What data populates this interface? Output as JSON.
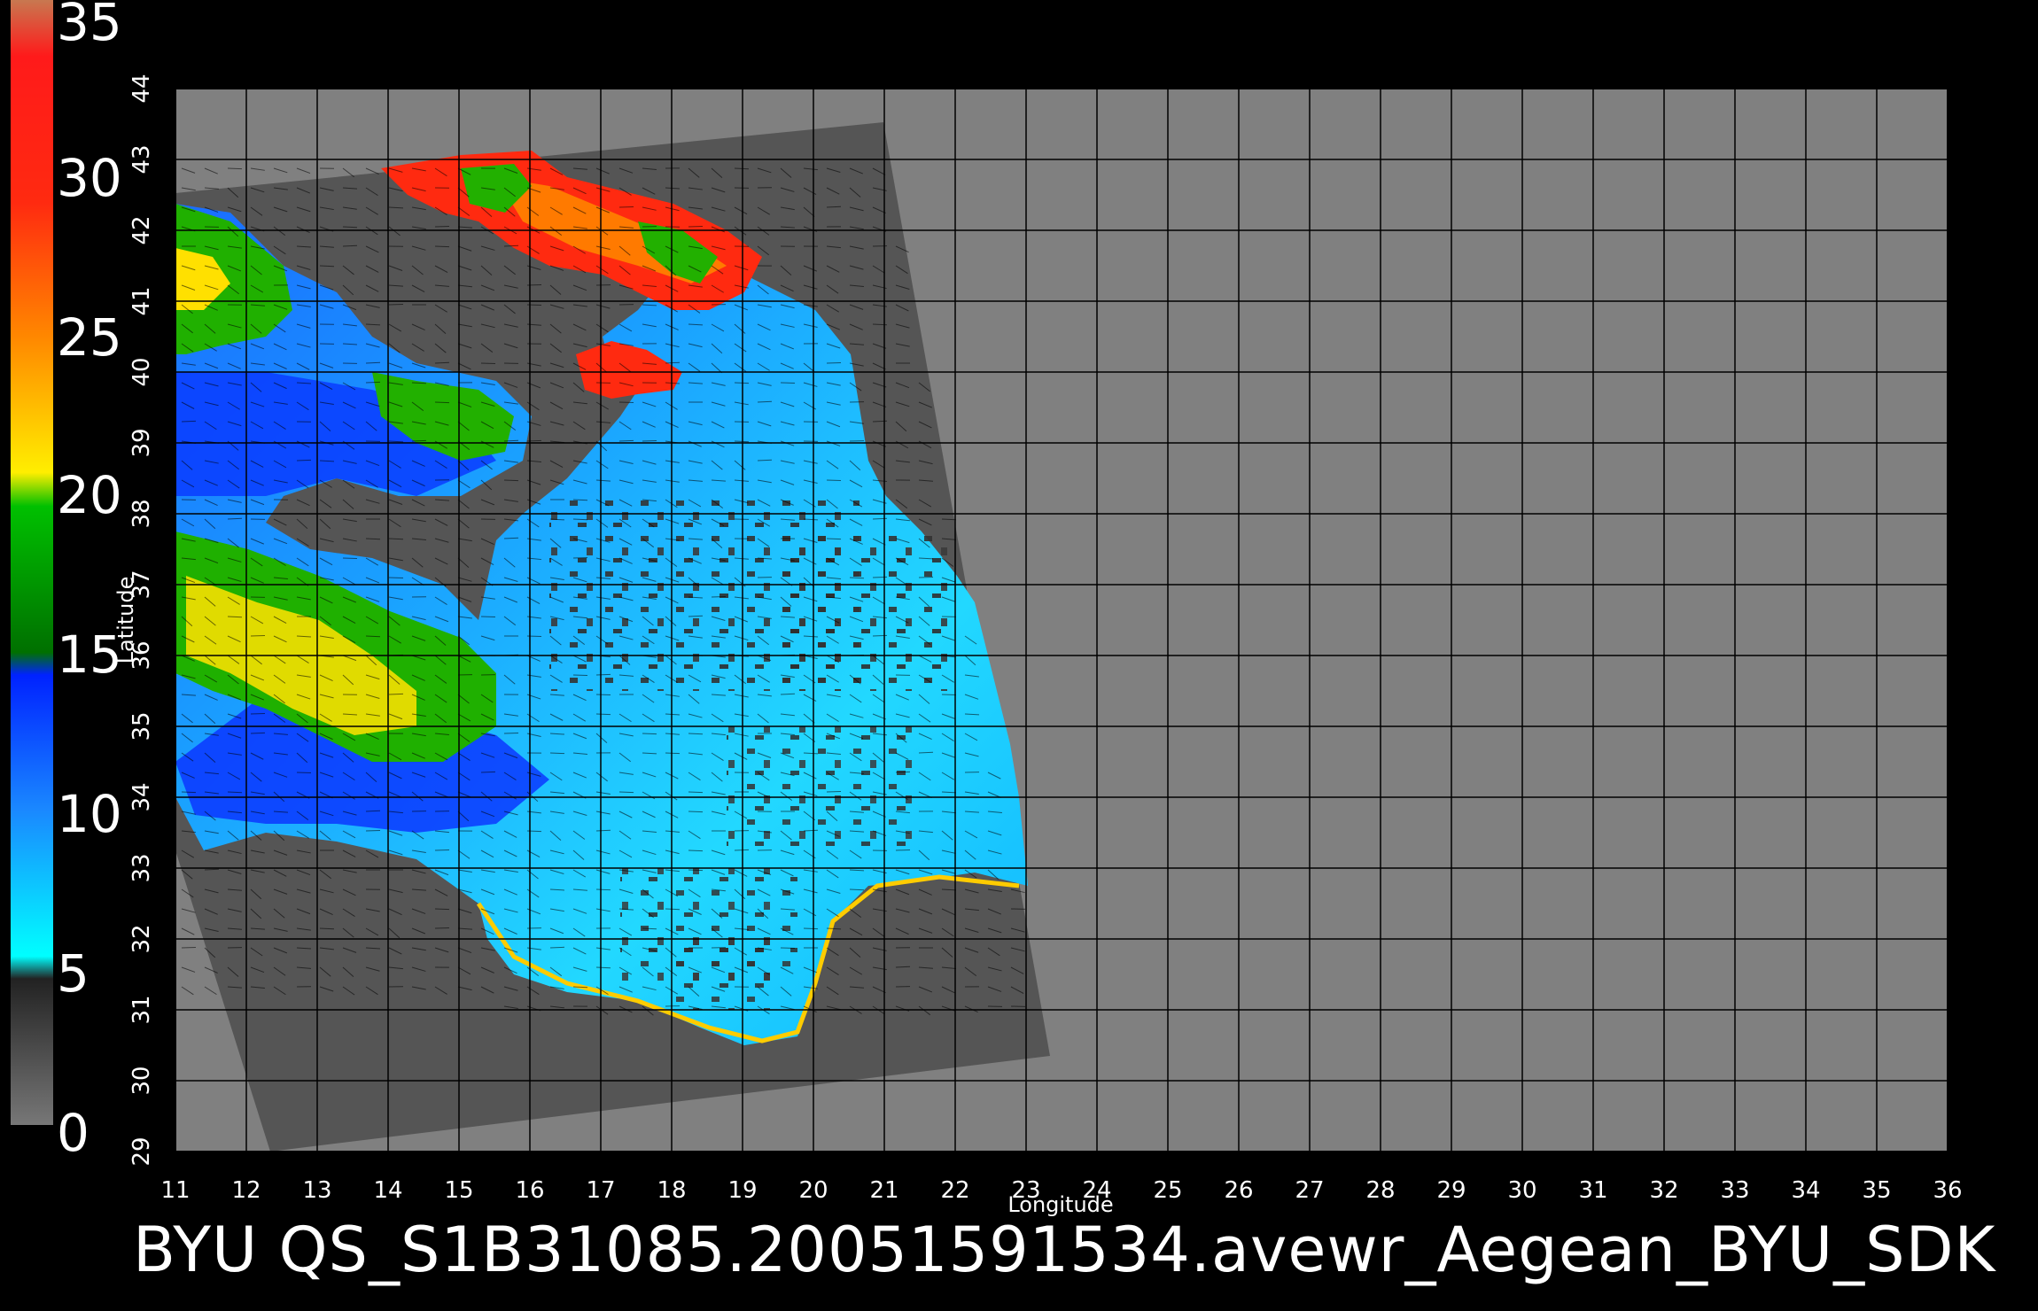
{
  "colorbar": {
    "labels": [
      "35",
      "30",
      "25",
      "20",
      "15",
      "10",
      "5",
      "0"
    ],
    "bands": [
      {
        "color": "#c87850"
      },
      {
        "color": "#ff1a1a"
      },
      {
        "color": "#e04010"
      },
      {
        "color": "#ff9900"
      },
      {
        "color": "#ffee00"
      },
      {
        "color": "#00b000"
      },
      {
        "color": "#0033ff"
      },
      {
        "color": "#00ffff"
      },
      {
        "color": "#555555"
      }
    ]
  },
  "map": {
    "xaxis_label": "Longitude",
    "yaxis_label": "Latitude",
    "longitudes": [
      "11",
      "12",
      "13",
      "14",
      "15",
      "16",
      "17",
      "18",
      "19",
      "20",
      "21",
      "22",
      "23",
      "24",
      "25",
      "26",
      "27",
      "28",
      "29",
      "30",
      "31",
      "32",
      "33",
      "34",
      "35",
      "36"
    ],
    "latitudes": [
      "44",
      "43",
      "42",
      "41",
      "40",
      "39",
      "38",
      "37",
      "36",
      "35",
      "34",
      "33",
      "32",
      "31",
      "30",
      "29"
    ],
    "background_color": "#808080",
    "swath_color": "#555555"
  },
  "caption": "BYU  QS_S1B31085.20051591534.avewr_Aegean_BYU_SDK"
}
